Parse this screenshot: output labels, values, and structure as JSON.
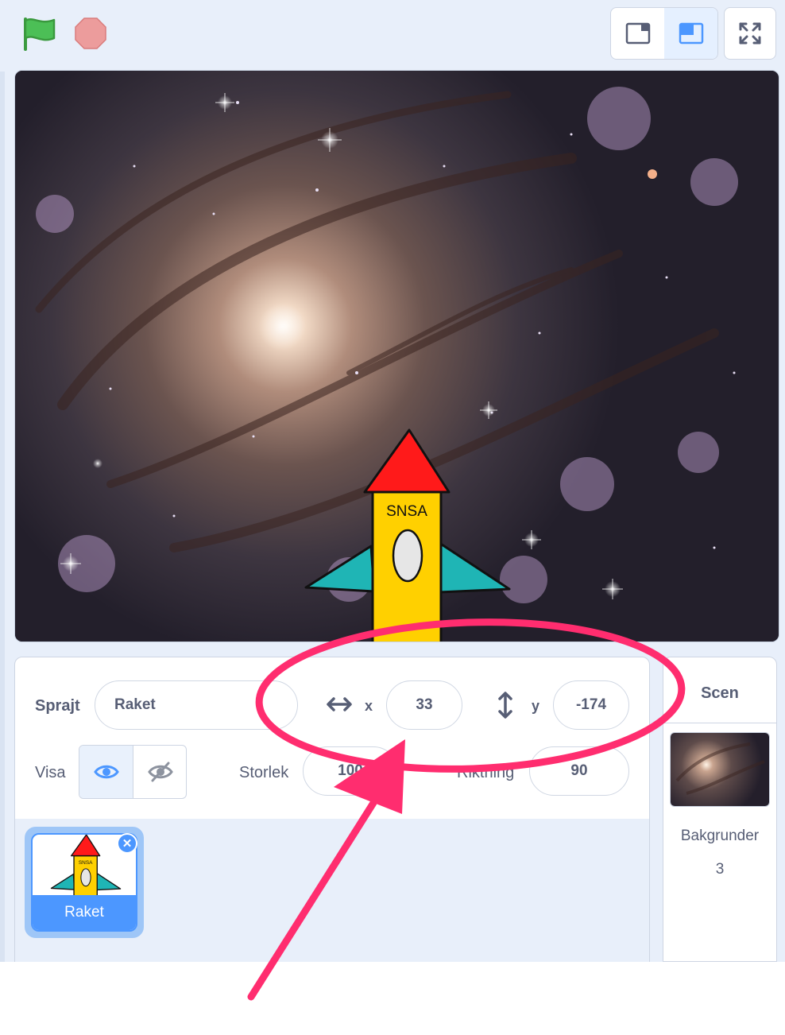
{
  "toolbar": {
    "green_flag_icon": "green-flag-icon",
    "stop_icon": "stop-sign-icon",
    "small_stage_icon": "small-stage-icon",
    "normal_stage_icon": "normal-stage-icon",
    "fullscreen_icon": "fullscreen-icon"
  },
  "stage": {
    "rocket_text": "SNSA"
  },
  "sprite_info": {
    "sprite_label": "Sprajt",
    "sprite_name": "Raket",
    "x_label": "x",
    "x_value": "33",
    "y_label": "y",
    "y_value": "-174",
    "show_label": "Visa",
    "size_label": "Storlek",
    "size_value": "100",
    "direction_label": "Riktning",
    "direction_value": "90"
  },
  "sprites": [
    {
      "name": "Raket",
      "thumb_text": "SNSA"
    }
  ],
  "stage_panel": {
    "title": "Scen",
    "backdrops_label": "Bakgrunder",
    "backdrops_count": "3"
  },
  "colors": {
    "accent": "#4c97ff",
    "annotation": "#ff2d6f",
    "flag": "#4cbf56",
    "stop": "#ec9c9c",
    "rocket_nose": "#ff1a1a",
    "rocket_body": "#ffd000",
    "rocket_fins": "#1fb5b5"
  }
}
